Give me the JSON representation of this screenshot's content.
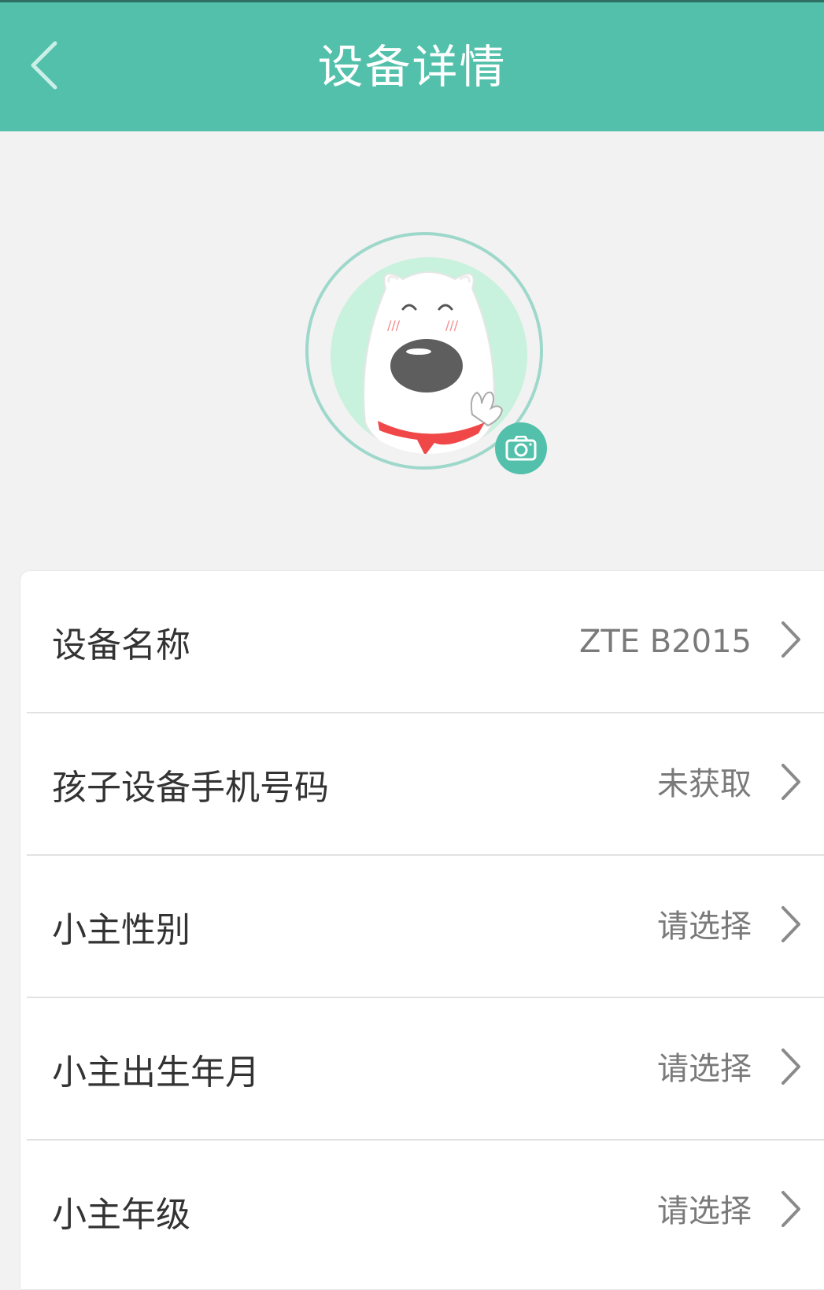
{
  "header": {
    "title": "设备详情",
    "back_icon": "back-arrow-icon",
    "color": "#52c0aa"
  },
  "avatar": {
    "icon": "dog-avatar",
    "camera_icon": "camera-icon"
  },
  "details": {
    "rows": [
      {
        "label": "设备名称",
        "value": "ZTE B2015"
      },
      {
        "label": "孩子设备手机号码",
        "value": "未获取"
      },
      {
        "label": "小主性别",
        "value": "请选择"
      },
      {
        "label": "小主出生年月",
        "value": "请选择"
      },
      {
        "label": "小主年级",
        "value": "请选择"
      }
    ],
    "chevron_icon": "chevron-right-icon"
  }
}
